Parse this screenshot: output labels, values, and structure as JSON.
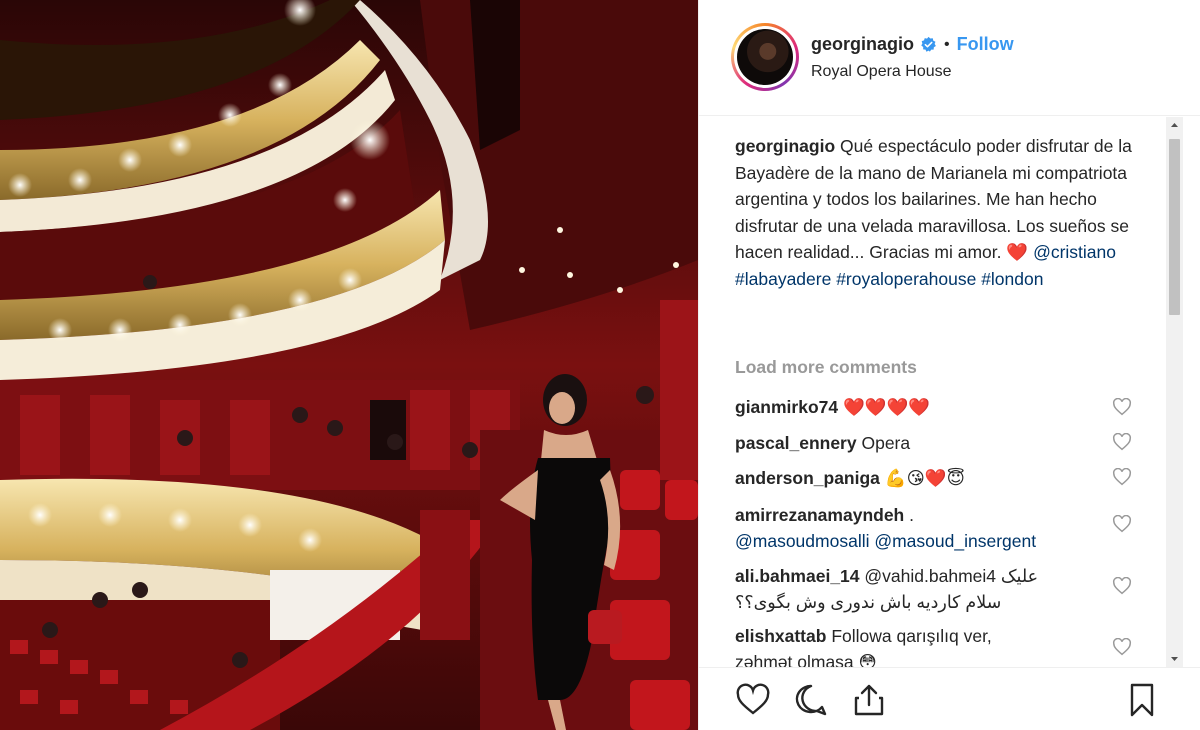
{
  "post": {
    "username": "georginagio",
    "verified": true,
    "separator": "•",
    "follow_label": "Follow",
    "location": "Royal Opera House"
  },
  "caption": {
    "author": "georginagio",
    "text": "Qué espectáculo poder disfrutar de la Bayadère de la mano de Marianela mi compatriota argentina y todos los bailarines. Me han hecho disfrutar de una velada maravillosa. Los sueños se hacen realidad... Gracias mi amor.",
    "heart": "❤️",
    "mention": "@cristiano",
    "hashtags": [
      "#labayadere",
      "#royaloperahouse",
      "#london"
    ]
  },
  "load_more_label": "Load more comments",
  "comments": [
    {
      "user": "gianmirko74",
      "text": "❤️❤️❤️❤️"
    },
    {
      "user": "pascal_ennery",
      "text": "Opera"
    },
    {
      "user": "anderson_paniga",
      "text": "💪😘❤️😇"
    },
    {
      "user": "amirrezanamayndeh",
      "text": ".",
      "line2": "@masoudmosalli @masoud_insergent"
    },
    {
      "user": "ali.bahmaei_14",
      "text": "@vahid.bahmei4 علیک",
      "line2": "سلام کاردیه باش ندوری وش بگوی؟؟"
    },
    {
      "user": "elishxattab",
      "text": "Followa qarışılıq ver,",
      "line2": "zəhmət olmasa 😳"
    }
  ],
  "icons": {
    "verified": "verified-badge-icon",
    "comment_like": "heart-outline-icon",
    "like": "heart-outline-icon",
    "comment": "comment-bubble-icon",
    "share": "share-upload-icon",
    "save": "bookmark-icon"
  },
  "colors": {
    "link": "#3897f0",
    "hashtag": "#003569",
    "muted": "#999999",
    "text": "#262626",
    "heart": "#ed1c24"
  }
}
